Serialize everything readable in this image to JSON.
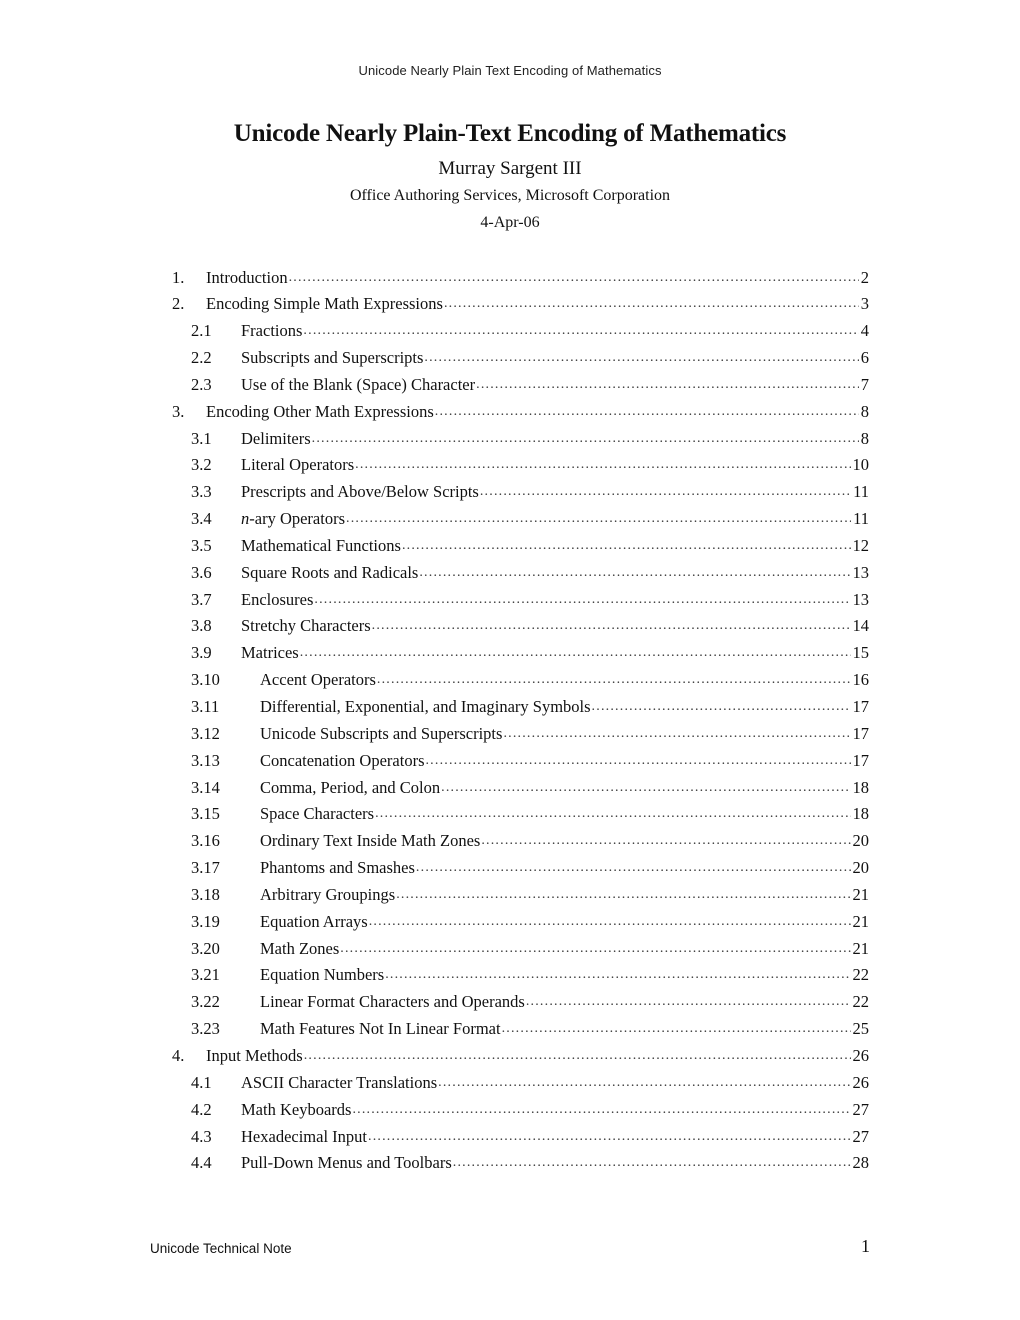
{
  "running_header": "Unicode Nearly Plain Text Encoding of Mathematics",
  "title": "Unicode Nearly Plain-Text Encoding of Mathematics",
  "author": "Murray Sargent III",
  "affiliation": "Office Authoring Services, Microsoft Corporation",
  "date": "4-Apr-06",
  "toc": [
    {
      "num": "1.",
      "label": "Introduction",
      "page": "2",
      "level": 1
    },
    {
      "num": "2.",
      "label": "Encoding Simple Math Expressions",
      "page": "3",
      "level": 1
    },
    {
      "num": "2.1",
      "label": "Fractions",
      "page": "4",
      "level": 2
    },
    {
      "num": "2.2",
      "label": "Subscripts and Superscripts",
      "page": "6",
      "level": 2
    },
    {
      "num": "2.3",
      "label": "Use of the Blank (Space) Character",
      "page": "7",
      "level": 2
    },
    {
      "num": "3.",
      "label": "Encoding Other Math Expressions",
      "page": "8",
      "level": 1
    },
    {
      "num": "3.1",
      "label": "Delimiters",
      "page": "8",
      "level": 2
    },
    {
      "num": "3.2",
      "label": "Literal Operators",
      "page": "10",
      "level": 2
    },
    {
      "num": "3.3",
      "label": "Prescripts and Above/Below Scripts",
      "page": "11",
      "level": 2
    },
    {
      "num": "3.4",
      "label_italic": "n",
      "label": "-ary Operators",
      "page": "11",
      "level": 2
    },
    {
      "num": "3.5",
      "label": "Mathematical Functions",
      "page": "12",
      "level": 2
    },
    {
      "num": "3.6",
      "label": "Square Roots and Radicals",
      "page": "13",
      "level": 2
    },
    {
      "num": "3.7",
      "label": "Enclosures",
      "page": "13",
      "level": 2
    },
    {
      "num": "3.8",
      "label": "Stretchy Characters",
      "page": "14",
      "level": 2
    },
    {
      "num": "3.9",
      "label": "Matrices",
      "page": "15",
      "level": 2
    },
    {
      "num": "3.10",
      "label": "Accent Operators",
      "page": "16",
      "level": 3
    },
    {
      "num": "3.11",
      "label": "Differential, Exponential, and Imaginary Symbols",
      "page": "17",
      "level": 3
    },
    {
      "num": "3.12",
      "label": "Unicode Subscripts and Superscripts",
      "page": "17",
      "level": 3
    },
    {
      "num": "3.13",
      "label": "Concatenation Operators",
      "page": "17",
      "level": 3
    },
    {
      "num": "3.14",
      "label": "Comma, Period, and Colon",
      "page": "18",
      "level": 3
    },
    {
      "num": "3.15",
      "label": "Space Characters",
      "page": "18",
      "level": 3
    },
    {
      "num": "3.16",
      "label": "Ordinary Text Inside Math Zones",
      "page": "20",
      "level": 3
    },
    {
      "num": "3.17",
      "label": "Phantoms and Smashes",
      "page": "20",
      "level": 3
    },
    {
      "num": "3.18",
      "label": "Arbitrary Groupings",
      "page": "21",
      "level": 3
    },
    {
      "num": "3.19",
      "label": "Equation Arrays",
      "page": "21",
      "level": 3
    },
    {
      "num": "3.20",
      "label": "Math Zones",
      "page": "21",
      "level": 3
    },
    {
      "num": "3.21",
      "label": "Equation Numbers",
      "page": "22",
      "level": 3
    },
    {
      "num": "3.22",
      "label": "Linear Format Characters and Operands",
      "page": "22",
      "level": 3
    },
    {
      "num": "3.23",
      "label": "Math Features Not In Linear Format",
      "page": "25",
      "level": 3
    },
    {
      "num": "4.",
      "label": "Input Methods",
      "page": "26",
      "level": 1
    },
    {
      "num": "4.1",
      "label": "ASCII Character Translations",
      "page": "26",
      "level": 2
    },
    {
      "num": "4.2",
      "label": "Math Keyboards",
      "page": "27",
      "level": 2
    },
    {
      "num": "4.3",
      "label": "Hexadecimal Input",
      "page": "27",
      "level": 2
    },
    {
      "num": "4.4",
      "label": "Pull-Down Menus and Toolbars",
      "page": "28",
      "level": 2
    }
  ],
  "footer": {
    "left": "Unicode Technical Note",
    "page_number": "1"
  }
}
